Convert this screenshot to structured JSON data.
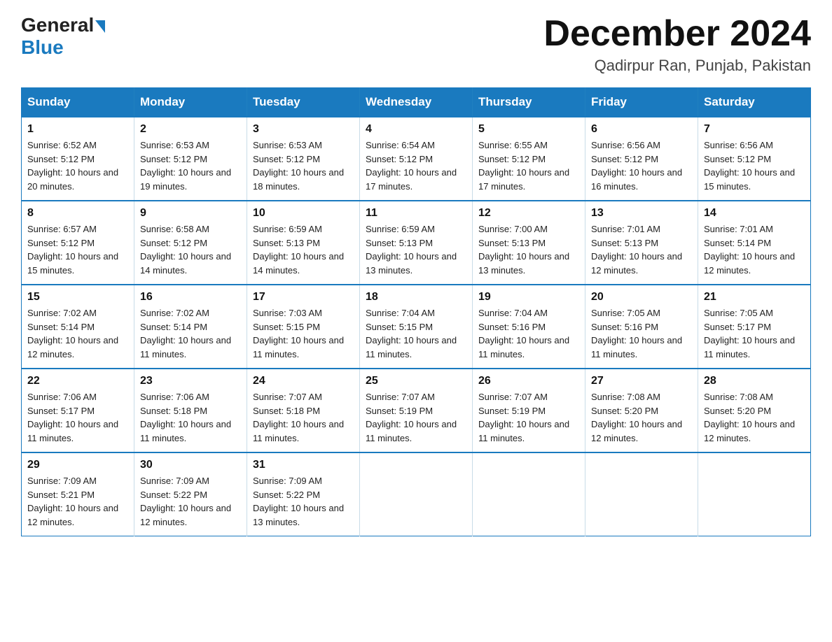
{
  "header": {
    "logo_general": "General",
    "logo_blue": "Blue",
    "month_title": "December 2024",
    "location": "Qadirpur Ran, Punjab, Pakistan"
  },
  "days_of_week": [
    "Sunday",
    "Monday",
    "Tuesday",
    "Wednesday",
    "Thursday",
    "Friday",
    "Saturday"
  ],
  "weeks": [
    [
      {
        "day": "1",
        "sunrise": "6:52 AM",
        "sunset": "5:12 PM",
        "daylight": "10 hours and 20 minutes."
      },
      {
        "day": "2",
        "sunrise": "6:53 AM",
        "sunset": "5:12 PM",
        "daylight": "10 hours and 19 minutes."
      },
      {
        "day": "3",
        "sunrise": "6:53 AM",
        "sunset": "5:12 PM",
        "daylight": "10 hours and 18 minutes."
      },
      {
        "day": "4",
        "sunrise": "6:54 AM",
        "sunset": "5:12 PM",
        "daylight": "10 hours and 17 minutes."
      },
      {
        "day": "5",
        "sunrise": "6:55 AM",
        "sunset": "5:12 PM",
        "daylight": "10 hours and 17 minutes."
      },
      {
        "day": "6",
        "sunrise": "6:56 AM",
        "sunset": "5:12 PM",
        "daylight": "10 hours and 16 minutes."
      },
      {
        "day": "7",
        "sunrise": "6:56 AM",
        "sunset": "5:12 PM",
        "daylight": "10 hours and 15 minutes."
      }
    ],
    [
      {
        "day": "8",
        "sunrise": "6:57 AM",
        "sunset": "5:12 PM",
        "daylight": "10 hours and 15 minutes."
      },
      {
        "day": "9",
        "sunrise": "6:58 AM",
        "sunset": "5:12 PM",
        "daylight": "10 hours and 14 minutes."
      },
      {
        "day": "10",
        "sunrise": "6:59 AM",
        "sunset": "5:13 PM",
        "daylight": "10 hours and 14 minutes."
      },
      {
        "day": "11",
        "sunrise": "6:59 AM",
        "sunset": "5:13 PM",
        "daylight": "10 hours and 13 minutes."
      },
      {
        "day": "12",
        "sunrise": "7:00 AM",
        "sunset": "5:13 PM",
        "daylight": "10 hours and 13 minutes."
      },
      {
        "day": "13",
        "sunrise": "7:01 AM",
        "sunset": "5:13 PM",
        "daylight": "10 hours and 12 minutes."
      },
      {
        "day": "14",
        "sunrise": "7:01 AM",
        "sunset": "5:14 PM",
        "daylight": "10 hours and 12 minutes."
      }
    ],
    [
      {
        "day": "15",
        "sunrise": "7:02 AM",
        "sunset": "5:14 PM",
        "daylight": "10 hours and 12 minutes."
      },
      {
        "day": "16",
        "sunrise": "7:02 AM",
        "sunset": "5:14 PM",
        "daylight": "10 hours and 11 minutes."
      },
      {
        "day": "17",
        "sunrise": "7:03 AM",
        "sunset": "5:15 PM",
        "daylight": "10 hours and 11 minutes."
      },
      {
        "day": "18",
        "sunrise": "7:04 AM",
        "sunset": "5:15 PM",
        "daylight": "10 hours and 11 minutes."
      },
      {
        "day": "19",
        "sunrise": "7:04 AM",
        "sunset": "5:16 PM",
        "daylight": "10 hours and 11 minutes."
      },
      {
        "day": "20",
        "sunrise": "7:05 AM",
        "sunset": "5:16 PM",
        "daylight": "10 hours and 11 minutes."
      },
      {
        "day": "21",
        "sunrise": "7:05 AM",
        "sunset": "5:17 PM",
        "daylight": "10 hours and 11 minutes."
      }
    ],
    [
      {
        "day": "22",
        "sunrise": "7:06 AM",
        "sunset": "5:17 PM",
        "daylight": "10 hours and 11 minutes."
      },
      {
        "day": "23",
        "sunrise": "7:06 AM",
        "sunset": "5:18 PM",
        "daylight": "10 hours and 11 minutes."
      },
      {
        "day": "24",
        "sunrise": "7:07 AM",
        "sunset": "5:18 PM",
        "daylight": "10 hours and 11 minutes."
      },
      {
        "day": "25",
        "sunrise": "7:07 AM",
        "sunset": "5:19 PM",
        "daylight": "10 hours and 11 minutes."
      },
      {
        "day": "26",
        "sunrise": "7:07 AM",
        "sunset": "5:19 PM",
        "daylight": "10 hours and 11 minutes."
      },
      {
        "day": "27",
        "sunrise": "7:08 AM",
        "sunset": "5:20 PM",
        "daylight": "10 hours and 12 minutes."
      },
      {
        "day": "28",
        "sunrise": "7:08 AM",
        "sunset": "5:20 PM",
        "daylight": "10 hours and 12 minutes."
      }
    ],
    [
      {
        "day": "29",
        "sunrise": "7:09 AM",
        "sunset": "5:21 PM",
        "daylight": "10 hours and 12 minutes."
      },
      {
        "day": "30",
        "sunrise": "7:09 AM",
        "sunset": "5:22 PM",
        "daylight": "10 hours and 12 minutes."
      },
      {
        "day": "31",
        "sunrise": "7:09 AM",
        "sunset": "5:22 PM",
        "daylight": "10 hours and 13 minutes."
      },
      null,
      null,
      null,
      null
    ]
  ]
}
